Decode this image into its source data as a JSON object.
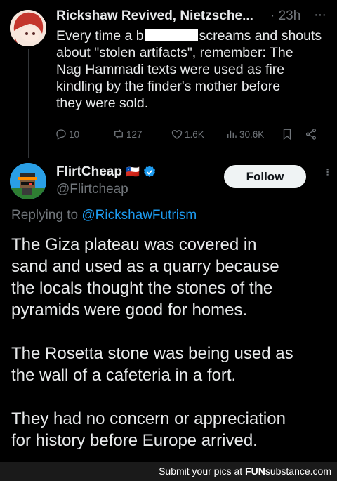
{
  "parent_tweet": {
    "display_name": "Rickshaw Revived, Nietzsche...",
    "time": "· 23h",
    "lines": [
      {
        "before": "Every time a b",
        "after": "screams and shouts"
      },
      {
        "text": "about \"stolen artifacts\", remember: The"
      },
      {
        "text": "Nag Hammadi texts were used as fire"
      },
      {
        "text": "kindling by the finder's mother before"
      },
      {
        "text": "they were sold."
      }
    ],
    "actions": {
      "replies": "10",
      "retweets": "127",
      "likes": "1.6K",
      "views": "30.6K"
    }
  },
  "reply_tweet": {
    "display_name": "FlirtCheap",
    "flag": "🇨🇱",
    "handle": "@Flirtcheap",
    "follow_label": "Follow",
    "replying_prefix": "Replying to",
    "replying_mention": "@RickshawFutrism",
    "paragraphs": [
      [
        "The Giza plateau was covered in",
        "sand and used as a quarry because",
        "the locals thought the stones of the",
        "pyramids were good for homes."
      ],
      [
        "The Rosetta stone was being used as",
        "the wall of a cafeteria in a fort."
      ],
      [
        "They had no concern or appreciation",
        "for history before Europe arrived."
      ]
    ]
  },
  "footer": {
    "prefix": "Submit your pics at",
    "brand_a": "FUN",
    "brand_b": "substance",
    "brand_c": ".com"
  },
  "colors": {
    "background": "#000000",
    "text": "#e7e9ea",
    "muted": "#71767b",
    "accent": "#1d9bf0"
  }
}
